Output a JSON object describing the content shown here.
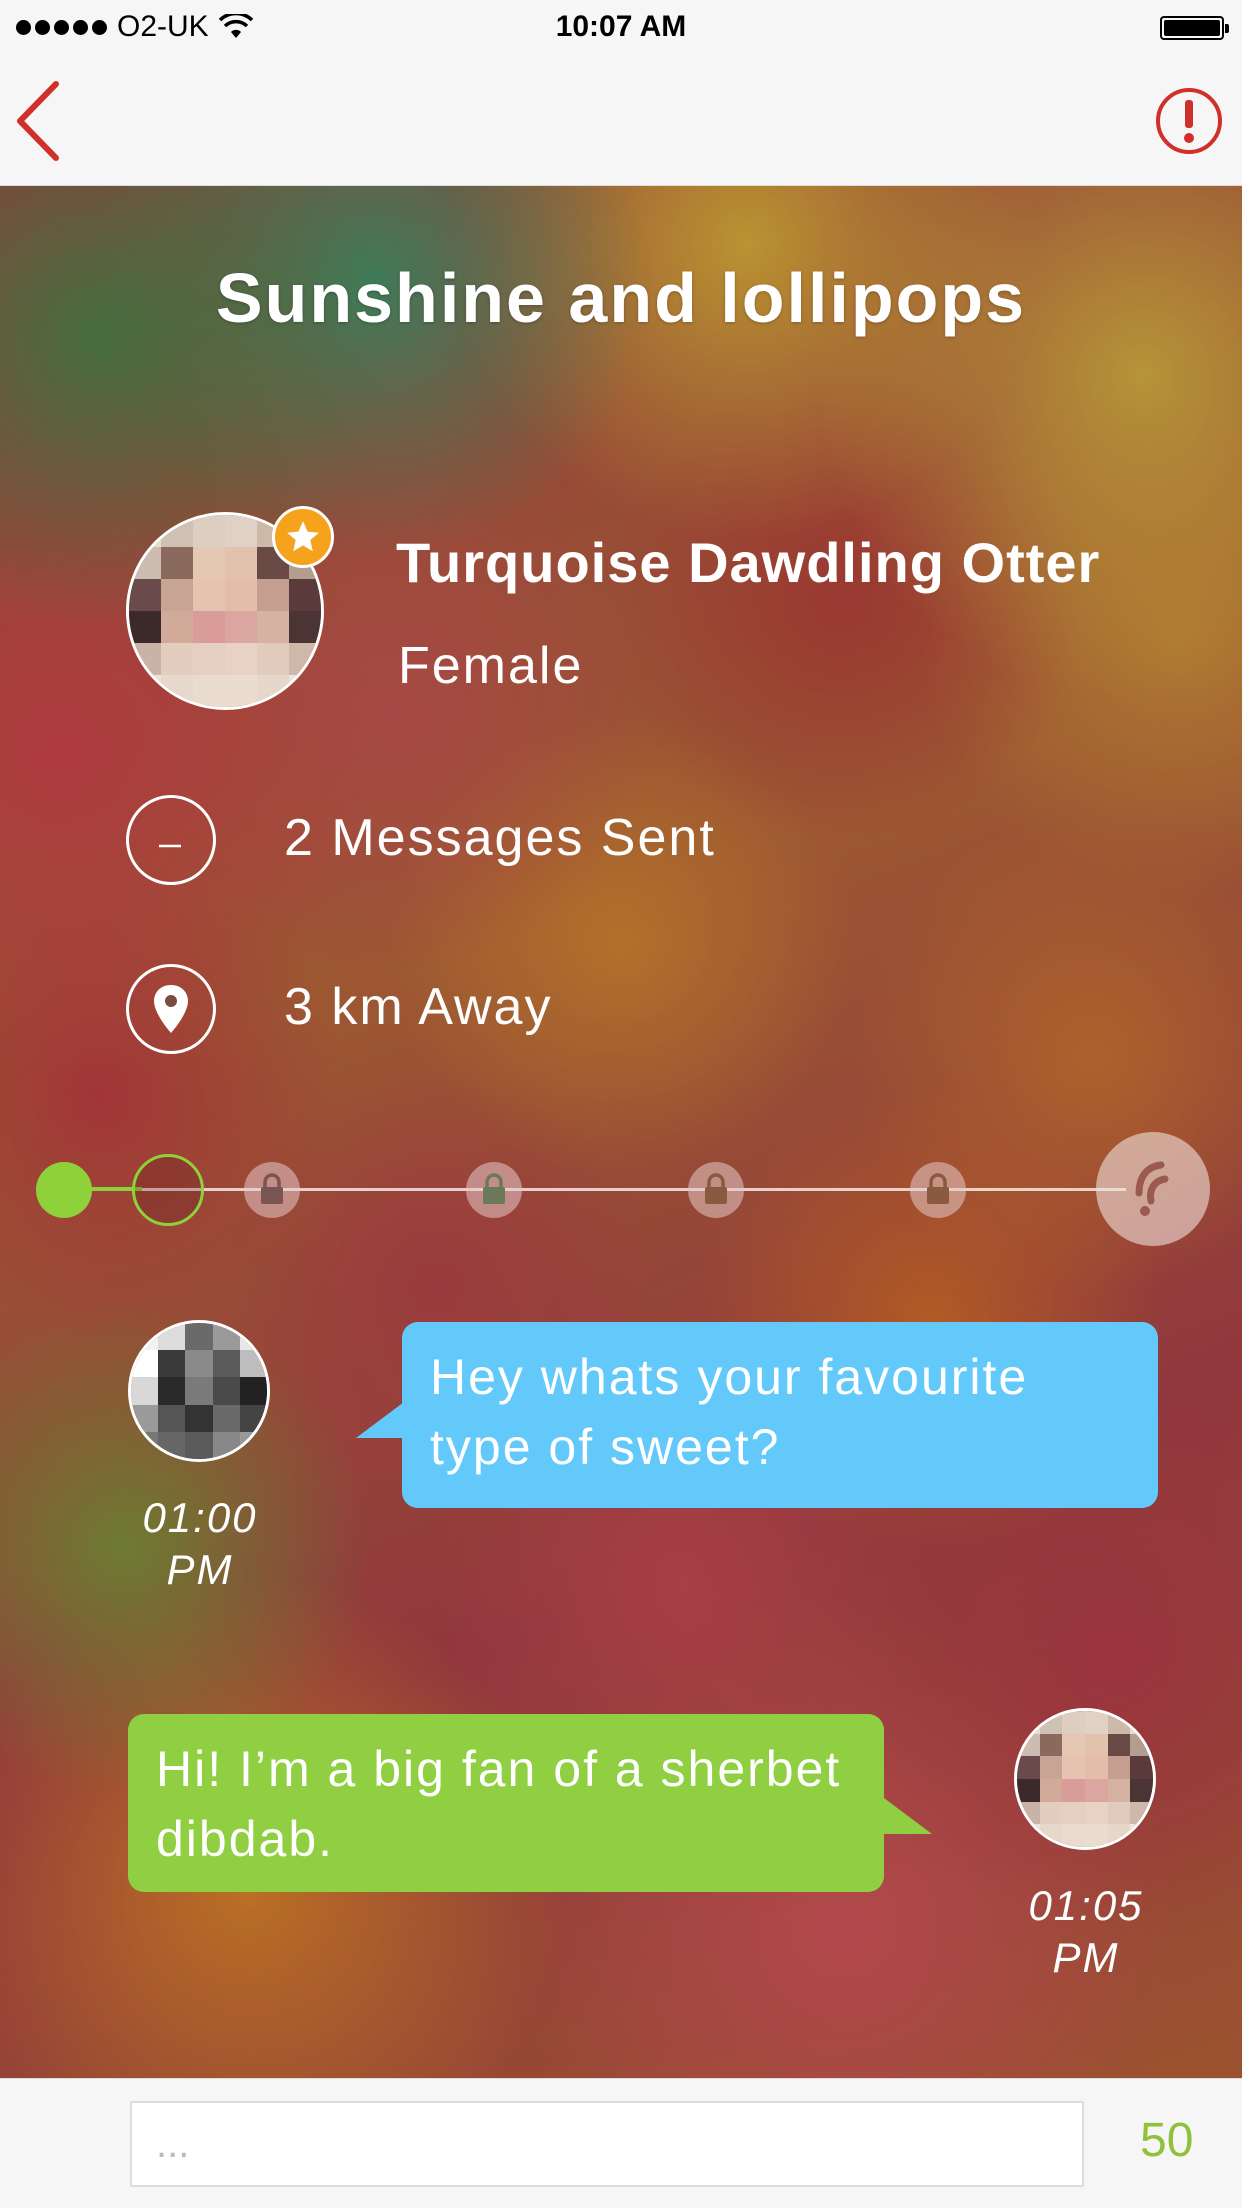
{
  "status_bar": {
    "carrier": "O2-UK",
    "time": "10:07 AM"
  },
  "conversation": {
    "title": "Sunshine and lollipops"
  },
  "profile": {
    "name": "Turquoise Dawdling Otter",
    "gender": "Female"
  },
  "stats": {
    "messages_sent": "2 Messages Sent",
    "distance": "3 km Away"
  },
  "progress": {
    "total_steps": 7,
    "completed_steps": 1,
    "current_step": 2,
    "locked_steps": 4
  },
  "messages": [
    {
      "text": "Hey whats your favourite type of sweet?",
      "time_line1": "01:00",
      "time_line2": "PM",
      "color": "#63c9fb",
      "from": "other"
    },
    {
      "text": "Hi! I’m a big fan of a sherbet dibdab.",
      "time_line1": "01:05",
      "time_line2": "PM",
      "color": "#8fcf41",
      "from": "me"
    }
  ],
  "input": {
    "placeholder": "...",
    "char_count": "50"
  },
  "colors": {
    "accent_red": "#d0302a",
    "accent_green": "#8fd13a",
    "bubble_blue": "#63c9fb",
    "badge_orange": "#f5a21c"
  },
  "icons": {
    "back": "chevron-left-icon",
    "report": "exclamation-circle-icon",
    "messages": "speech-bubble-icon",
    "distance": "map-pin-icon",
    "locked_step": "padlock-icon",
    "final_step": "brand-logo-icon",
    "badge": "star-icon"
  }
}
